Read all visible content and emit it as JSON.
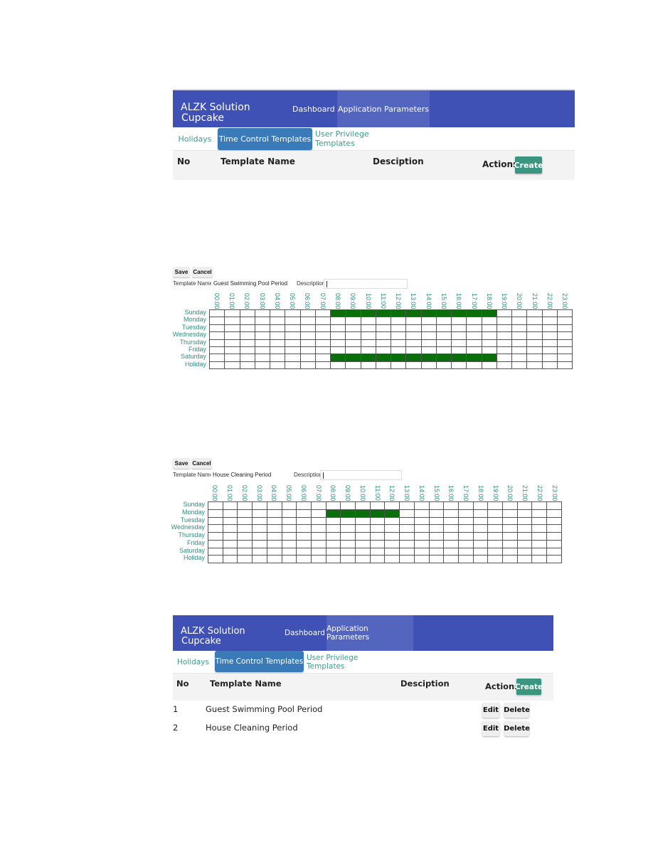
{
  "app": {
    "brand_line1": "ALZK Solution",
    "brand_line2": "Cupcake",
    "nav": [
      {
        "label": "Dashboard",
        "active": false
      },
      {
        "label": "Application Parameters",
        "active": true
      }
    ],
    "tabs": [
      {
        "label": "Holidays",
        "active": false
      },
      {
        "label": "Time Control Templates",
        "active": true
      },
      {
        "label": "User Privilege Templates",
        "active": false
      }
    ],
    "table_headers": {
      "no": "No",
      "name": "Template Name",
      "description": "Desciption",
      "actions": "Actions"
    },
    "create_label": "Create",
    "edit_label": "Edit",
    "delete_label": "Delete"
  },
  "list_initial": {
    "rows": []
  },
  "list_final": {
    "rows": [
      {
        "no": "1",
        "name": "Guest Swimming Pool Period",
        "description": ""
      },
      {
        "no": "2",
        "name": "House Cleaning Period",
        "description": ""
      }
    ]
  },
  "editor_common": {
    "save_label": "Save",
    "cancel_label": "Cancel",
    "template_name_label": "Template Name:",
    "description_label": "Description",
    "hours": [
      "00:00",
      "01:00",
      "02:00",
      "03:00",
      "04:00",
      "05:00",
      "06:00",
      "07:00",
      "08:00",
      "09:00",
      "10:00",
      "11:00",
      "12:00",
      "13:00",
      "14:00",
      "15:00",
      "16:00",
      "17:00",
      "18:00",
      "19:00",
      "20:00",
      "21:00",
      "22:00",
      "23:00"
    ],
    "days": [
      "Sunday",
      "Monday",
      "Tuesday",
      "Wednesday",
      "Thursday",
      "Friday",
      "Saturday",
      "Holiday"
    ],
    "active_color": "#0a6e0a"
  },
  "editors": [
    {
      "template_name": "Guest Swimming Pool Period",
      "description": "",
      "active": {
        "Sunday": [
          "08:00",
          "09:00",
          "10:00",
          "11:00",
          "12:00",
          "13:00",
          "14:00",
          "15:00",
          "16:00",
          "17:00",
          "18:00"
        ],
        "Saturday": [
          "08:00",
          "09:00",
          "10:00",
          "11:00",
          "12:00",
          "13:00",
          "14:00",
          "15:00",
          "16:00",
          "17:00",
          "18:00"
        ]
      }
    },
    {
      "template_name": "House Cleaning Period",
      "description": "",
      "active": {
        "Monday": [
          "08:00",
          "09:00",
          "10:00",
          "11:00",
          "12:00"
        ]
      }
    }
  ],
  "colors": {
    "navbar": "#3f51b5",
    "nav_active": "#5465c0",
    "tab_active": "#3a7ab8",
    "teal_text": "#3a9d8c",
    "create_button": "#3a9680"
  }
}
